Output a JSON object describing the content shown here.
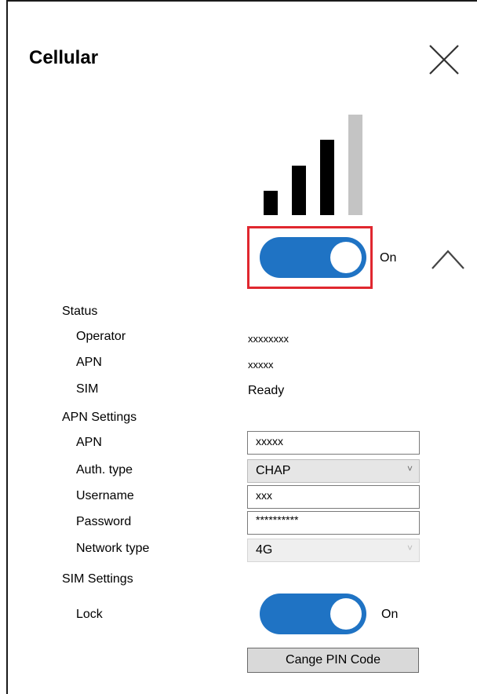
{
  "window": {
    "title": "Cellular"
  },
  "signal": {
    "bars_total": 4,
    "bars_active": 3,
    "active_color": "#000000",
    "inactive_color": "#c4c4c4"
  },
  "cellular_toggle": {
    "state_label": "On",
    "on": true,
    "color": "#1f73c4"
  },
  "status": {
    "heading": "Status",
    "operator_label": "Operator",
    "operator_value": "xxxxxxxx",
    "apn_label": "APN",
    "apn_value": "xxxxx",
    "sim_label": "SIM",
    "sim_value": "Ready"
  },
  "apn_settings": {
    "heading": "APN Settings",
    "apn_label": "APN",
    "apn_value": "xxxxx",
    "auth_label": "Auth. type",
    "auth_value": "CHAP",
    "username_label": "Username",
    "username_value": "xxx",
    "password_label": "Password",
    "password_value": "**********",
    "network_label": "Network type",
    "network_value": "4G"
  },
  "sim_settings": {
    "heading": "SIM Settings",
    "lock_label": "Lock",
    "lock_state_label": "On",
    "change_pin_label": "Cange PIN Code"
  },
  "accent": {
    "highlight_border": "#e0272f"
  }
}
